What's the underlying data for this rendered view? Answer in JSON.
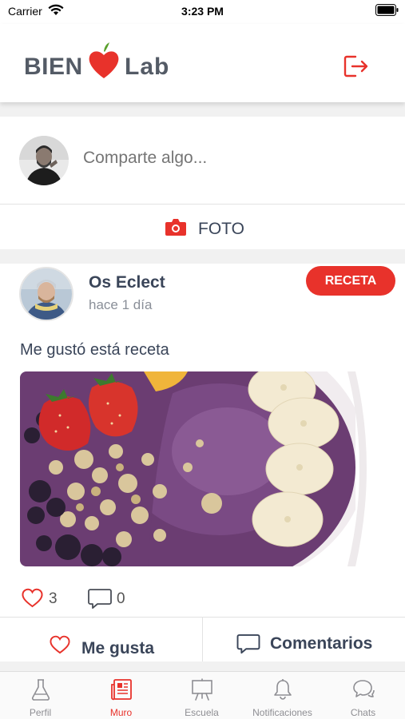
{
  "status_bar": {
    "carrier": "Carrier",
    "time": "3:23 PM"
  },
  "header": {
    "logo_left": "BIEN",
    "logo_right": "Lab",
    "brand_color": "#e8322b",
    "logout_icon": "logout-icon"
  },
  "composer": {
    "placeholder": "Comparte algo...",
    "photo_button": "FOTO"
  },
  "post": {
    "author": "Os Eclect",
    "time": "hace 1 día",
    "tag": "RECETA",
    "text": "Me gustó está receta",
    "likes": "3",
    "comments": "0",
    "like_action": "Me gusta",
    "comment_action": "Comentarios"
  },
  "tabbar": {
    "active": "Muro",
    "tabs": [
      {
        "label": "Perfil",
        "icon": "flask-icon"
      },
      {
        "label": "Muro",
        "icon": "newspaper-icon"
      },
      {
        "label": "Escuela",
        "icon": "easel-icon"
      },
      {
        "label": "Notificaciones",
        "icon": "bell-icon"
      },
      {
        "label": "Chats",
        "icon": "chat-bubbles-icon"
      }
    ]
  }
}
